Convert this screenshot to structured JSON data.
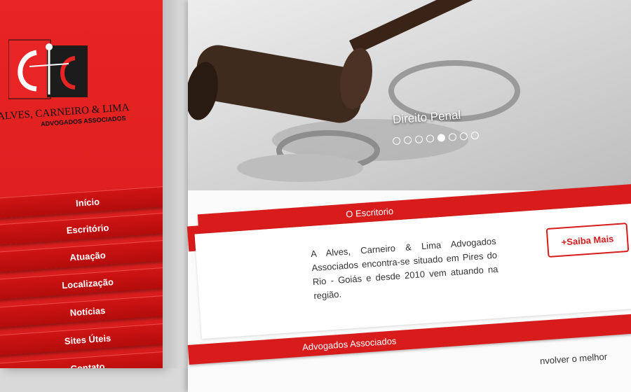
{
  "brand": {
    "name": "ALVES, CARNEIRO & LIMA",
    "subtitle": "ADVOGADOS ASSOCIADOS",
    "colors": {
      "primary": "#d81c1c",
      "dark": "#111111"
    }
  },
  "nav": {
    "items": [
      {
        "label": "Início"
      },
      {
        "label": "Escritório"
      },
      {
        "label": "Atuação"
      },
      {
        "label": "Localização"
      },
      {
        "label": "Notícias"
      },
      {
        "label": "Sites Úteis"
      },
      {
        "label": "Contato"
      }
    ]
  },
  "slider": {
    "caption": "Direito Penal",
    "dot_count": 8,
    "active_dot": 5
  },
  "about": {
    "heading": "O Escritorio",
    "text": "A Alves, Carneiro & Lima Advogados Associados encontra-se situado em Pires do Rio - Goiás e desde 2010 vem atuando na região.",
    "button_label": "+Saiba Mais"
  },
  "associates": {
    "heading": "Advogados Associados",
    "text_partial": "nvolver o melhor"
  }
}
